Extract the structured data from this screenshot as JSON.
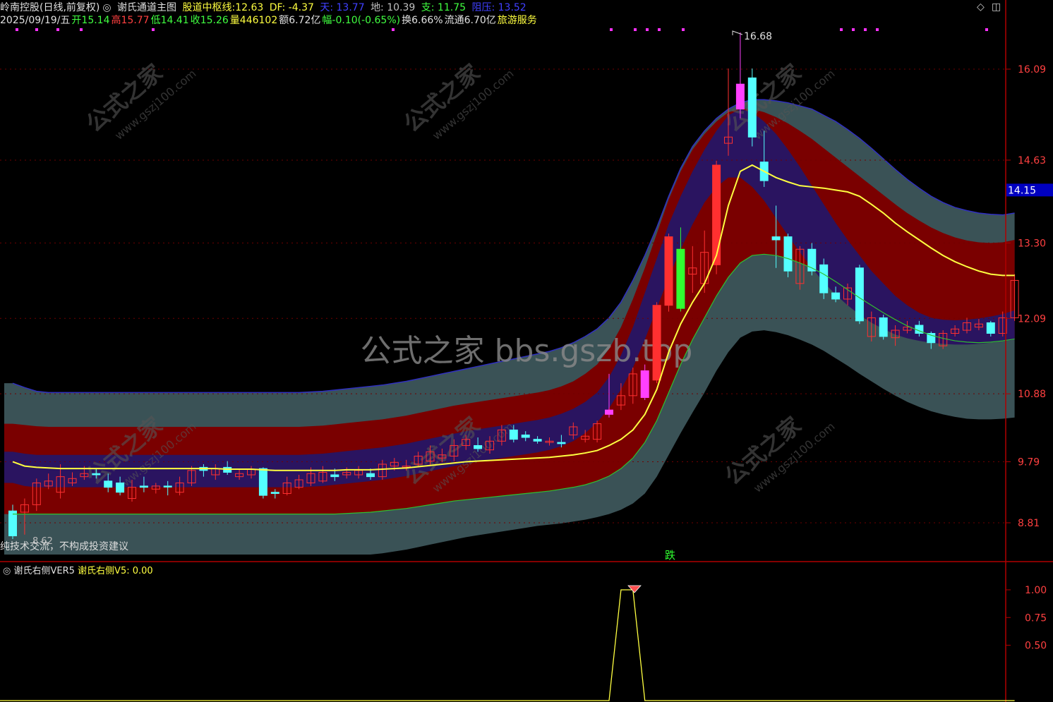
{
  "header": {
    "stock_name": "岭南控股(日线,前复权)",
    "indicator": "谢氏通道主图",
    "center_label": "股道中枢线:",
    "center_value": "12.63",
    "df": "DF: -4.37",
    "tian": "天: 13.77",
    "di": "地: 10.39",
    "zhi": "支: 11.75",
    "zuya": "阻压: 13.52"
  },
  "quote": {
    "date": "2025/09/19/五",
    "open": "开15.14",
    "high": "高15.77",
    "low": "低14.41",
    "close": "收15.26",
    "volume": "量446102",
    "amount": "额6.72亿",
    "change": "幅-0.10(-0.65%)",
    "turnover": "换6.66%",
    "float": "流通6.70亿",
    "sector": "旅游服务"
  },
  "disclaimer": "纯技术交流，不构成投资建议",
  "watermark_center": "公式之家 bbs.gszb.top",
  "watermark_tile_a": "公式之家",
  "watermark_tile_b": "www.gszj100.com",
  "signal_label": "跌",
  "current_price_tag": "14.15",
  "peak_label": "16.68",
  "low_label": "8.62",
  "sub_panel": {
    "name": "谢氏右侧VER5",
    "value_label": "谢氏右侧V5: 0.00"
  },
  "colors": {
    "up": "#ff3030",
    "down": "#54ffff",
    "center_line": "#ffff40",
    "outer_band": "#3a5256",
    "middle_band": "#7a0000",
    "inner_band": "#2a1460",
    "axis": "#b00000",
    "label_red": "#ff4040"
  },
  "chart_data": {
    "type": "candlestick",
    "y_axis_ticks": [
      16.09,
      14.63,
      13.3,
      12.09,
      10.88,
      9.79,
      8.81
    ],
    "sub_y_axis_ticks": [
      1.0,
      0.75,
      0.5
    ],
    "ylim": [
      7.9,
      17.2
    ],
    "candles": [
      [
        9.0,
        8.6,
        9.1,
        8.55
      ],
      [
        8.98,
        9.1,
        9.2,
        8.62
      ],
      [
        9.1,
        9.45,
        9.52,
        9.0
      ],
      [
        9.4,
        9.48,
        9.6,
        9.35
      ],
      [
        9.3,
        9.55,
        9.75,
        9.2
      ],
      [
        9.45,
        9.52,
        9.62,
        9.4
      ],
      [
        9.55,
        9.6,
        9.72,
        9.5
      ],
      [
        9.6,
        9.58,
        9.68,
        9.52
      ],
      [
        9.48,
        9.38,
        9.6,
        9.3
      ],
      [
        9.45,
        9.3,
        9.55,
        9.25
      ],
      [
        9.2,
        9.38,
        9.5,
        9.15
      ],
      [
        9.4,
        9.38,
        9.55,
        9.3
      ],
      [
        9.35,
        9.4,
        9.45,
        9.28
      ],
      [
        9.4,
        9.39,
        9.48,
        9.25
      ],
      [
        9.3,
        9.45,
        9.55,
        9.25
      ],
      [
        9.45,
        9.65,
        9.72,
        9.4
      ],
      [
        9.7,
        9.65,
        9.75,
        9.55
      ],
      [
        9.58,
        9.68,
        9.75,
        9.5
      ],
      [
        9.7,
        9.62,
        9.8,
        9.58
      ],
      [
        9.55,
        9.6,
        9.68,
        9.5
      ],
      [
        9.58,
        9.67,
        9.72,
        9.52
      ],
      [
        9.68,
        9.25,
        9.7,
        9.2
      ],
      [
        9.3,
        9.28,
        9.35,
        9.2
      ],
      [
        9.28,
        9.45,
        9.55,
        9.25
      ],
      [
        9.38,
        9.5,
        9.58,
        9.35
      ],
      [
        9.45,
        9.6,
        9.7,
        9.4
      ],
      [
        9.48,
        9.62,
        9.72,
        9.45
      ],
      [
        9.58,
        9.55,
        9.68,
        9.48
      ],
      [
        9.58,
        9.62,
        9.7,
        9.52
      ],
      [
        9.58,
        9.65,
        9.72,
        9.52
      ],
      [
        9.6,
        9.55,
        9.68,
        9.5
      ],
      [
        9.55,
        9.75,
        9.82,
        9.5
      ],
      [
        9.72,
        9.78,
        9.85,
        9.65
      ],
      [
        9.7,
        9.72,
        9.82,
        9.65
      ],
      [
        9.75,
        9.88,
        9.95,
        9.7
      ],
      [
        9.8,
        9.95,
        10.05,
        9.72
      ],
      [
        9.85,
        9.9,
        10.0,
        9.78
      ],
      [
        9.88,
        10.05,
        10.15,
        9.8
      ],
      [
        10.05,
        10.15,
        10.22,
        9.98
      ],
      [
        10.05,
        10.0,
        10.18,
        9.95
      ],
      [
        9.98,
        10.12,
        10.2,
        9.92
      ],
      [
        10.12,
        10.3,
        10.38,
        10.05
      ],
      [
        10.3,
        10.15,
        10.38,
        10.1
      ],
      [
        10.22,
        10.18,
        10.28,
        10.12
      ],
      [
        10.15,
        10.12,
        10.2,
        10.08
      ],
      [
        10.1,
        10.12,
        10.18,
        10.05
      ],
      [
        10.1,
        10.08,
        10.22,
        10.02
      ],
      [
        10.22,
        10.35,
        10.42,
        10.15
      ],
      [
        10.15,
        10.2,
        10.3,
        10.1
      ],
      [
        10.15,
        10.4,
        10.45,
        10.1
      ],
      [
        10.55,
        10.62,
        11.2,
        10.5
      ],
      [
        10.7,
        10.85,
        11.05,
        10.62
      ],
      [
        10.85,
        11.2,
        11.3,
        10.72
      ],
      [
        11.25,
        10.82,
        11.35,
        10.78
      ],
      [
        11.1,
        12.3,
        12.35,
        11.05
      ],
      [
        12.3,
        13.4,
        13.45,
        12.2
      ],
      [
        13.2,
        12.25,
        13.55,
        12.2
      ],
      [
        12.8,
        12.9,
        13.25,
        12.5
      ],
      [
        12.65,
        13.15,
        13.5,
        12.5
      ],
      [
        12.95,
        14.55,
        14.62,
        12.8
      ],
      [
        14.9,
        15.0,
        16.1,
        14.7
      ],
      [
        15.45,
        15.85,
        16.68,
        15.3
      ],
      [
        15.95,
        15.0,
        16.1,
        14.85
      ],
      [
        14.6,
        14.3,
        15.1,
        14.2
      ],
      [
        13.4,
        13.35,
        13.9,
        12.9
      ],
      [
        13.4,
        12.85,
        13.45,
        12.75
      ],
      [
        12.65,
        13.2,
        13.25,
        12.55
      ],
      [
        13.2,
        12.85,
        13.3,
        12.78
      ],
      [
        12.95,
        12.5,
        13.05,
        12.4
      ],
      [
        12.5,
        12.4,
        12.6,
        12.35
      ],
      [
        12.4,
        12.58,
        12.65,
        12.3
      ],
      [
        12.9,
        12.05,
        12.95,
        12.0
      ],
      [
        11.8,
        12.1,
        12.2,
        11.72
      ],
      [
        12.1,
        11.8,
        12.15,
        11.75
      ],
      [
        11.78,
        11.9,
        11.98,
        11.65
      ],
      [
        11.9,
        11.95,
        12.05,
        11.85
      ],
      [
        11.98,
        11.85,
        12.05,
        11.8
      ],
      [
        11.85,
        11.7,
        11.88,
        11.6
      ],
      [
        11.65,
        11.85,
        11.9,
        11.6
      ],
      [
        11.85,
        11.92,
        11.98,
        11.8
      ],
      [
        11.9,
        12.02,
        12.1,
        11.85
      ],
      [
        11.95,
        12.0,
        12.08,
        11.9
      ],
      [
        12.02,
        11.85,
        12.05,
        11.8
      ],
      [
        11.85,
        12.1,
        12.2,
        11.8
      ],
      [
        12.1,
        12.7,
        12.8,
        12.05
      ]
    ],
    "center_line": [
      9.79,
      9.72,
      9.7,
      9.69,
      9.68,
      9.68,
      9.68,
      9.68,
      9.68,
      9.68,
      9.68,
      9.68,
      9.68,
      9.68,
      9.68,
      9.68,
      9.68,
      9.68,
      9.67,
      9.67,
      9.67,
      9.66,
      9.65,
      9.65,
      9.65,
      9.65,
      9.65,
      9.65,
      9.66,
      9.66,
      9.66,
      9.67,
      9.68,
      9.69,
      9.71,
      9.73,
      9.75,
      9.77,
      9.79,
      9.8,
      9.81,
      9.82,
      9.83,
      9.84,
      9.85,
      9.86,
      9.88,
      9.9,
      9.93,
      9.97,
      10.05,
      10.15,
      10.3,
      10.55,
      10.95,
      11.55,
      12.0,
      12.35,
      12.65,
      13.1,
      13.9,
      14.45,
      14.55,
      14.45,
      14.35,
      14.28,
      14.22,
      14.2,
      14.18,
      14.15,
      14.12,
      14.05,
      13.92,
      13.78,
      13.62,
      13.48,
      13.35,
      13.22,
      13.1,
      13.0,
      12.92,
      12.85,
      12.8,
      12.78,
      12.78
    ],
    "outer_upper": [
      11.05,
      10.98,
      10.92,
      10.9,
      10.9,
      10.9,
      10.9,
      10.9,
      10.9,
      10.9,
      10.9,
      10.9,
      10.9,
      10.9,
      10.9,
      10.9,
      10.9,
      10.9,
      10.9,
      10.9,
      10.9,
      10.9,
      10.9,
      10.9,
      10.9,
      10.91,
      10.92,
      10.94,
      10.96,
      10.98,
      11.0,
      11.02,
      11.05,
      11.08,
      11.12,
      11.16,
      11.2,
      11.24,
      11.28,
      11.32,
      11.36,
      11.4,
      11.44,
      11.48,
      11.52,
      11.56,
      11.62,
      11.7,
      11.8,
      11.92,
      12.1,
      12.35,
      12.7,
      13.1,
      13.55,
      14.05,
      14.5,
      14.85,
      15.1,
      15.3,
      15.45,
      15.55,
      15.6,
      15.6,
      15.58,
      15.55,
      15.5,
      15.45,
      15.35,
      15.25,
      15.12,
      14.98,
      14.82,
      14.65,
      14.48,
      14.32,
      14.18,
      14.05,
      13.95,
      13.87,
      13.82,
      13.78,
      13.76,
      13.75,
      13.78
    ],
    "outer_lower": [
      8.3,
      8.3,
      8.3,
      8.3,
      8.3,
      8.3,
      8.3,
      8.3,
      8.3,
      8.3,
      8.3,
      8.3,
      8.3,
      8.3,
      8.3,
      8.3,
      8.3,
      8.3,
      8.3,
      8.3,
      8.3,
      8.3,
      8.3,
      8.3,
      8.3,
      8.3,
      8.3,
      8.3,
      8.3,
      8.3,
      8.3,
      8.32,
      8.35,
      8.38,
      8.42,
      8.46,
      8.5,
      8.54,
      8.58,
      8.61,
      8.64,
      8.67,
      8.7,
      8.73,
      8.76,
      8.78,
      8.8,
      8.83,
      8.86,
      8.9,
      8.95,
      9.02,
      9.12,
      9.28,
      9.55,
      9.9,
      10.25,
      10.58,
      10.9,
      11.25,
      11.55,
      11.78,
      11.88,
      11.9,
      11.87,
      11.82,
      11.75,
      11.67,
      11.57,
      11.45,
      11.33,
      11.2,
      11.08,
      10.96,
      10.85,
      10.75,
      10.67,
      10.6,
      10.55,
      10.51,
      10.48,
      10.47,
      10.47,
      10.48,
      10.5
    ],
    "middle_upper": [
      10.4,
      10.38,
      10.36,
      10.35,
      10.35,
      10.35,
      10.35,
      10.35,
      10.35,
      10.35,
      10.35,
      10.35,
      10.35,
      10.35,
      10.35,
      10.35,
      10.35,
      10.35,
      10.35,
      10.35,
      10.35,
      10.35,
      10.35,
      10.35,
      10.35,
      10.36,
      10.37,
      10.39,
      10.41,
      10.43,
      10.45,
      10.47,
      10.5,
      10.53,
      10.57,
      10.61,
      10.65,
      10.69,
      10.72,
      10.75,
      10.78,
      10.81,
      10.84,
      10.87,
      10.9,
      10.94,
      11.0,
      11.08,
      11.2,
      11.35,
      11.6,
      11.95,
      12.4,
      12.9,
      13.45,
      14.0,
      14.45,
      14.8,
      15.05,
      15.25,
      15.4,
      15.45,
      15.45,
      15.4,
      15.32,
      15.22,
      15.1,
      14.97,
      14.82,
      14.67,
      14.52,
      14.37,
      14.22,
      14.07,
      13.92,
      13.78,
      13.66,
      13.55,
      13.46,
      13.39,
      13.34,
      13.31,
      13.3,
      13.31,
      13.35
    ],
    "middle_lower": [
      8.95,
      8.95,
      8.95,
      8.95,
      8.95,
      8.95,
      8.95,
      8.95,
      8.95,
      8.95,
      8.95,
      8.95,
      8.95,
      8.95,
      8.95,
      8.95,
      8.95,
      8.95,
      8.95,
      8.95,
      8.95,
      8.95,
      8.95,
      8.95,
      8.95,
      8.95,
      8.95,
      8.95,
      8.96,
      8.97,
      8.98,
      9.0,
      9.02,
      9.04,
      9.07,
      9.1,
      9.13,
      9.16,
      9.18,
      9.2,
      9.22,
      9.24,
      9.26,
      9.28,
      9.3,
      9.32,
      9.35,
      9.38,
      9.42,
      9.48,
      9.56,
      9.68,
      9.85,
      10.1,
      10.45,
      10.9,
      11.35,
      11.75,
      12.1,
      12.45,
      12.75,
      12.98,
      13.1,
      13.12,
      13.1,
      13.05,
      12.98,
      12.9,
      12.8,
      12.68,
      12.55,
      12.42,
      12.3,
      12.18,
      12.07,
      11.97,
      11.89,
      11.82,
      11.77,
      11.73,
      11.71,
      11.7,
      11.71,
      11.73,
      11.76
    ],
    "inner_upper": [
      9.95,
      9.92,
      9.9,
      9.9,
      9.9,
      9.9,
      9.9,
      9.9,
      9.9,
      9.9,
      9.9,
      9.9,
      9.9,
      9.9,
      9.9,
      9.9,
      9.9,
      9.9,
      9.9,
      9.9,
      9.9,
      9.9,
      9.9,
      9.9,
      9.9,
      9.91,
      9.92,
      9.94,
      9.96,
      9.98,
      10.0,
      10.02,
      10.05,
      10.08,
      10.12,
      10.16,
      10.2,
      10.24,
      10.28,
      10.31,
      10.34,
      10.37,
      10.4,
      10.43,
      10.46,
      10.5,
      10.56,
      10.64,
      10.75,
      10.9,
      11.15,
      11.5,
      11.95,
      12.5,
      13.05,
      13.6,
      14.05,
      14.45,
      14.8,
      15.1,
      15.35,
      15.45,
      15.4,
      15.25,
      15.05,
      14.8,
      14.52,
      14.22,
      13.92,
      13.62,
      13.35,
      13.1,
      12.85,
      12.65,
      12.45,
      12.3,
      12.18,
      12.1,
      12.07,
      12.06,
      12.07,
      12.09,
      12.12,
      12.16,
      12.22
    ],
    "inner_lower": [
      9.45,
      9.4,
      9.38,
      9.38,
      9.38,
      9.38,
      9.38,
      9.38,
      9.38,
      9.38,
      9.38,
      9.38,
      9.38,
      9.38,
      9.38,
      9.38,
      9.38,
      9.38,
      9.38,
      9.38,
      9.38,
      9.38,
      9.38,
      9.38,
      9.38,
      9.39,
      9.4,
      9.42,
      9.44,
      9.46,
      9.48,
      9.5,
      9.53,
      9.56,
      9.6,
      9.64,
      9.68,
      9.72,
      9.76,
      9.79,
      9.82,
      9.85,
      9.88,
      9.91,
      9.94,
      9.98,
      10.04,
      10.12,
      10.25,
      10.42,
      10.65,
      10.95,
      11.3,
      11.75,
      12.25,
      12.75,
      13.2,
      13.6,
      13.95,
      14.2,
      14.35,
      14.35,
      14.2,
      13.98,
      13.7,
      13.42,
      13.15,
      12.9,
      12.67,
      12.47,
      12.3,
      12.15,
      12.02,
      11.92,
      11.83,
      11.77,
      11.73,
      11.7,
      11.68,
      11.67,
      11.67,
      11.68,
      11.7,
      11.72,
      11.75
    ],
    "support_line": [
      8.95,
      8.95,
      8.95,
      8.95,
      8.95,
      8.95,
      8.95,
      8.95,
      8.95,
      8.95,
      8.95,
      8.95,
      8.95,
      8.95,
      8.95,
      8.95,
      8.95,
      8.95,
      8.95,
      8.95,
      8.95,
      8.95,
      8.95,
      8.95,
      8.95,
      8.95,
      8.95,
      8.95,
      8.96,
      8.97,
      8.98,
      9.0,
      9.02,
      9.04,
      9.07,
      9.1,
      9.13,
      9.16,
      9.18,
      9.2,
      9.22,
      9.24,
      9.26,
      9.28,
      9.3,
      9.32,
      9.35,
      9.38,
      9.42,
      9.48,
      9.56,
      9.68,
      9.85,
      10.1,
      10.45,
      10.9,
      11.35,
      11.75,
      12.1,
      12.45,
      12.75,
      12.98,
      13.1,
      13.12,
      13.1,
      13.05,
      12.98,
      12.9,
      12.8,
      12.68,
      12.55,
      12.42,
      12.3,
      12.18,
      12.07,
      11.97,
      11.89,
      11.82,
      11.77,
      11.73,
      11.71,
      11.7,
      11.71,
      11.73,
      11.76
    ],
    "sub_signal": [
      0,
      0,
      0,
      0,
      0,
      0,
      0,
      0,
      0,
      0,
      0,
      0,
      0,
      0,
      0,
      0,
      0,
      0,
      0,
      0,
      0,
      0,
      0,
      0,
      0,
      0,
      0,
      0,
      0,
      0,
      0,
      0,
      0,
      0,
      0,
      0,
      0,
      0,
      0,
      0,
      0,
      0,
      0,
      0,
      0,
      0,
      0,
      0,
      0,
      0,
      0,
      1,
      1,
      0,
      0,
      0,
      0,
      0,
      0,
      0,
      0,
      0,
      0,
      0,
      0,
      0,
      0,
      0,
      0,
      0,
      0,
      0,
      0,
      0,
      0,
      0,
      0,
      0,
      0,
      0,
      0,
      0,
      0,
      0,
      0
    ]
  }
}
